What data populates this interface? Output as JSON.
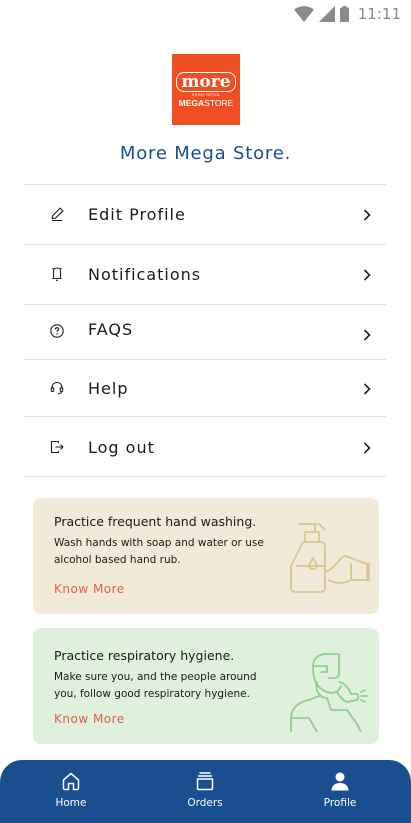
{
  "status_bar": {
    "time": "11:11",
    "icons": [
      "wifi-icon",
      "cellular-signal-icon",
      "battery-icon"
    ]
  },
  "logo": {
    "top_text": "more",
    "sub_text": "GREAT RETAIL",
    "bottom_text_bold": "MEGA",
    "bottom_text": "STORE",
    "color": "#f04e23"
  },
  "store_title": "More Mega Store.",
  "menu": {
    "items": [
      {
        "label": "Edit Profile",
        "icon": "pencil-icon"
      },
      {
        "label": "Notifications",
        "icon": "bell-icon"
      },
      {
        "label": "FAQS",
        "icon": "help-circle-icon"
      },
      {
        "label": "Help",
        "icon": "headset-icon"
      },
      {
        "label": "Log out",
        "icon": "logout-icon"
      }
    ]
  },
  "cards": [
    {
      "title": "Practice frequent hand washing.",
      "body": "Wash hands with soap and water or use alcohol based hand rub.",
      "link": "Know More",
      "illustration": "hand-sanitizer-icon",
      "background": "#f1ead9"
    },
    {
      "title": "Practice respiratory hygiene.",
      "body": "Make sure you, and the people around you, follow good respiratory hygiene.",
      "link": "Know More",
      "illustration": "person-sneezing-icon",
      "background": "#dff0dc"
    }
  ],
  "bottom_nav": {
    "items": [
      {
        "label": "Home",
        "icon": "home-icon"
      },
      {
        "label": "Orders",
        "icon": "orders-icon"
      },
      {
        "label": "Profile",
        "icon": "profile-icon"
      }
    ],
    "active": "Profile",
    "background": "#1a4f8f"
  },
  "colors": {
    "accent": "#1a4f8f",
    "link": "#e0604a"
  }
}
